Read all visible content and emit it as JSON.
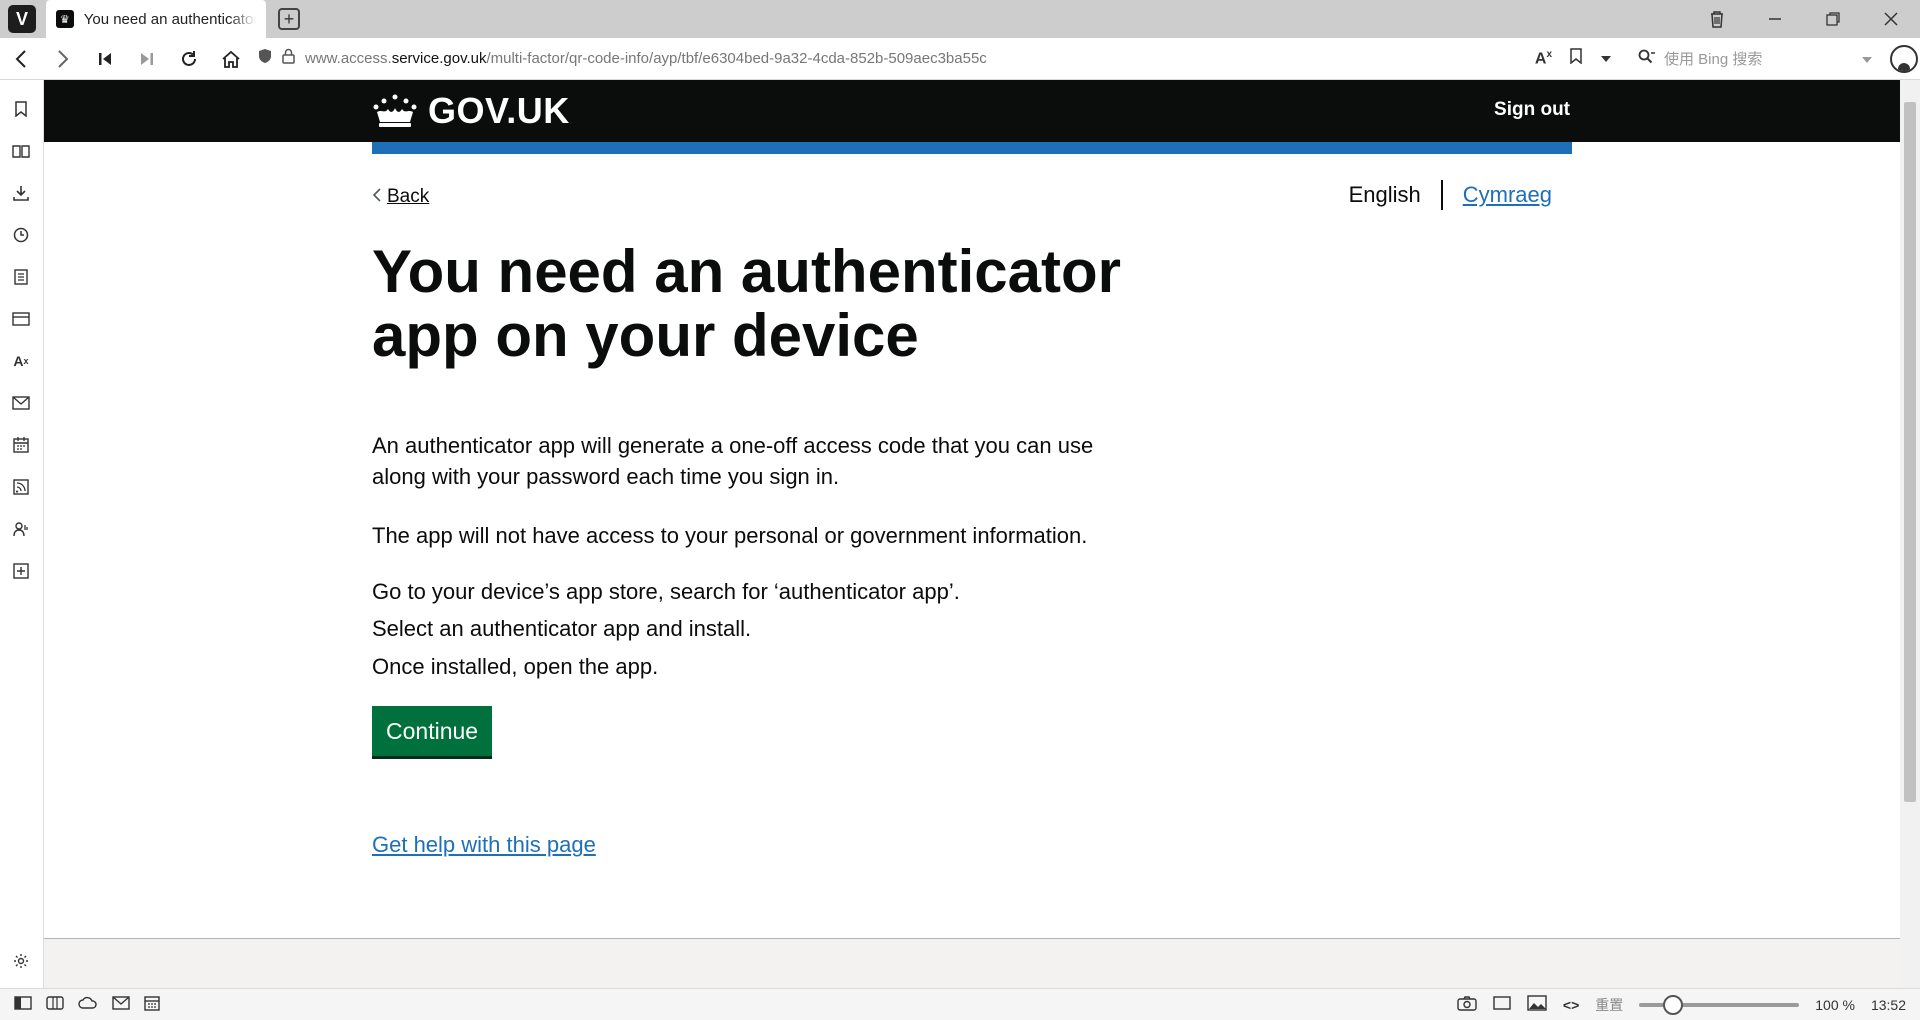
{
  "browser": {
    "tab_title": "You need an authenticator app on your device",
    "url_prefix": "www.access.",
    "url_host": "service.gov.uk",
    "url_path": "/multi-factor/qr-code-info/ayp/tbf/e6304bed-9a32-4cda-852b-509aec3ba55c",
    "search_placeholder": "使用 Bing 搜索"
  },
  "header": {
    "logo_text": "GOV.UK",
    "sign_out": "Sign out"
  },
  "nav": {
    "back": "Back"
  },
  "language": {
    "current": "English",
    "other": "Cymraeg"
  },
  "main": {
    "title": "You need an authenticator app on your device",
    "paragraph_1": "An authenticator app will generate a one-off access code that you can use along with your password each time you sign in.",
    "paragraph_2": "The app will not have access to your personal or government information.",
    "step_1": "Go to your device’s app store, search for ‘authenticator app’.",
    "step_2": "Select an authenticator app and install.",
    "step_3": "Once installed, open the app.",
    "continue_button": "Continue",
    "help_link": "Get help with this page"
  },
  "statusbar": {
    "reset_label": "重置",
    "zoom": "100 %",
    "time": "13:52"
  },
  "colors": {
    "header_bg": "#0b0c0c",
    "brand_blue": "#1d70b8",
    "button_green": "#00703c",
    "text": "#0b0c0c"
  },
  "icons": {
    "sidebar": [
      "bookmark-icon",
      "reading-list-icon",
      "downloads-icon",
      "history-icon",
      "notes-icon",
      "window-panel-icon",
      "translate-icon",
      "mail-icon",
      "calendar-icon",
      "feeds-icon",
      "contacts-icon",
      "add-panel-icon",
      "settings-icon"
    ]
  }
}
